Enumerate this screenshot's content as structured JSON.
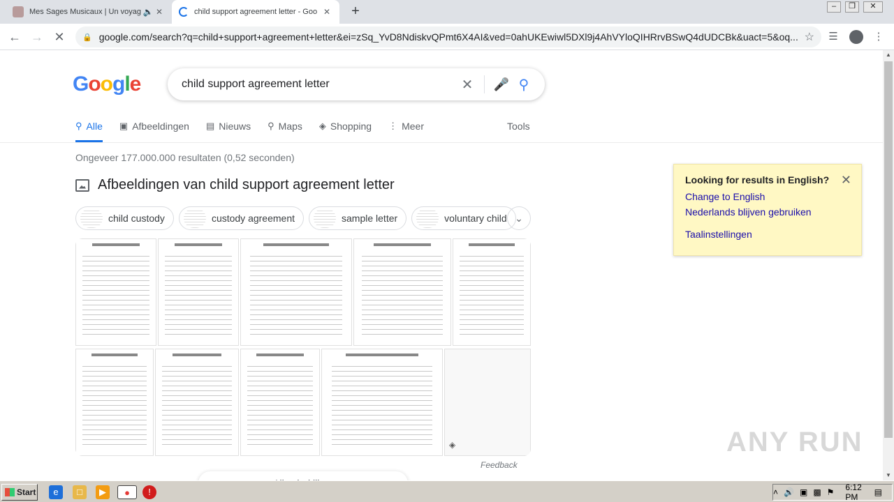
{
  "browser": {
    "tabs": [
      {
        "title": "Mes Sages Musicaux | Un voyag",
        "active": false,
        "audio_icon": "speaker-icon"
      },
      {
        "title": "child support agreement letter - Goo",
        "active": true,
        "loading": true
      }
    ],
    "url": "google.com/search?q=child+support+agreement+letter&ei=zSq_YvD8NdiskvQPmt6X4AI&ved=0ahUKEwiwl5DXl9j4AhVYloQIHRrvBSwQ4dUDCBk&uact=5&oq..."
  },
  "search": {
    "logo": "Google",
    "query": "child support agreement letter",
    "tabs": [
      {
        "label": "Alle",
        "icon": "search-icon"
      },
      {
        "label": "Afbeeldingen",
        "icon": "image-icon"
      },
      {
        "label": "Nieuws",
        "icon": "news-icon"
      },
      {
        "label": "Maps",
        "icon": "map-pin-icon"
      },
      {
        "label": "Shopping",
        "icon": "tag-icon"
      },
      {
        "label": "Meer",
        "icon": "more-vert-icon"
      }
    ],
    "tools_label": "Tools",
    "stats": "Ongeveer 177.000.000 resultaten (0,52 seconden)",
    "images_heading": "Afbeeldingen van child support agreement letter",
    "chips": [
      "child custody",
      "custody agreement",
      "sample letter",
      "voluntary child"
    ],
    "feedback": "Feedback",
    "more_button": "Alles bekijken"
  },
  "language_prompt": {
    "title": "Looking for results in English?",
    "change_link": "Change to English",
    "stay_link": "Nederlands blijven gebruiken",
    "settings_link": "Taalinstellingen"
  },
  "watermark": "ANY RUN",
  "taskbar": {
    "start_label": "Start",
    "clock": "6:12 PM"
  },
  "colors": {
    "accent": "#1a73e8",
    "link": "#1a0dab",
    "notice_bg": "#fff8c4"
  }
}
